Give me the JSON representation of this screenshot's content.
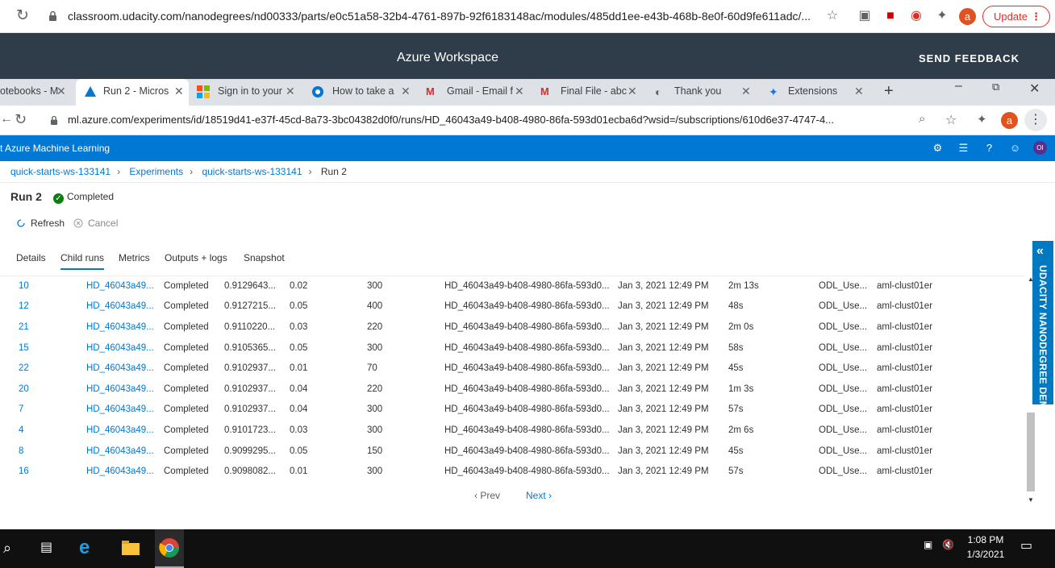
{
  "outer": {
    "url": "classroom.udacity.com/nanodegrees/nd00333/parts/e0c51a58-32b4-4761-897b-92f6183148ac/modules/485dd1ee-e43b-468b-8e0f-60d9fe611adc/...",
    "avatar": "a",
    "update": "Update"
  },
  "udacity": {
    "title": "Azure Workspace",
    "feedback": "SEND FEEDBACK"
  },
  "tabs": [
    {
      "label": "otebooks - M"
    },
    {
      "label": "Run 2 - Micros"
    },
    {
      "label": "Sign in to your"
    },
    {
      "label": "How to take a"
    },
    {
      "label": "Gmail - Email f"
    },
    {
      "label": "Final File - abc"
    },
    {
      "label": "Thank you"
    },
    {
      "label": "Extensions"
    }
  ],
  "inner": {
    "url": "ml.azure.com/experiments/id/18519d41-e37f-45cd-8a73-3bc04382d0f0/runs/HD_46043a49-b408-4980-86fa-593d01ecba6d?wsid=/subscriptions/610d6e37-4747-4...",
    "avatar": "a"
  },
  "aml": {
    "name": "t Azure Machine Learning",
    "user": "OI"
  },
  "breadcrumb": [
    "quick-starts-ws-133141",
    "Experiments",
    "quick-starts-ws-133141",
    "Run 2"
  ],
  "run": {
    "title": "Run 2",
    "status": "Completed"
  },
  "commands": {
    "refresh": "Refresh",
    "cancel": "Cancel"
  },
  "detail_tabs": [
    "Details",
    "Child runs",
    "Metrics",
    "Outputs + logs",
    "Snapshot"
  ],
  "rows": [
    {
      "num": "10",
      "id": "HD_46043a49...",
      "status": "Completed",
      "acc": "0.9129643...",
      "c": "0.02",
      "iter": "300",
      "parent": "HD_46043a49-b408-4980-86fa-593d0...",
      "date": "Jan 3, 2021 12:49 PM",
      "dur": "2m 13s",
      "user": "ODL_Use...",
      "target": "aml-clust01er"
    },
    {
      "num": "12",
      "id": "HD_46043a49...",
      "status": "Completed",
      "acc": "0.9127215...",
      "c": "0.05",
      "iter": "400",
      "parent": "HD_46043a49-b408-4980-86fa-593d0...",
      "date": "Jan 3, 2021 12:49 PM",
      "dur": "48s",
      "user": "ODL_Use...",
      "target": "aml-clust01er"
    },
    {
      "num": "21",
      "id": "HD_46043a49...",
      "status": "Completed",
      "acc": "0.9110220...",
      "c": "0.03",
      "iter": "220",
      "parent": "HD_46043a49-b408-4980-86fa-593d0...",
      "date": "Jan 3, 2021 12:49 PM",
      "dur": "2m 0s",
      "user": "ODL_Use...",
      "target": "aml-clust01er"
    },
    {
      "num": "15",
      "id": "HD_46043a49...",
      "status": "Completed",
      "acc": "0.9105365...",
      "c": "0.05",
      "iter": "300",
      "parent": "HD_46043a49-b408-4980-86fa-593d0...",
      "date": "Jan 3, 2021 12:49 PM",
      "dur": "58s",
      "user": "ODL_Use...",
      "target": "aml-clust01er"
    },
    {
      "num": "22",
      "id": "HD_46043a49...",
      "status": "Completed",
      "acc": "0.9102937...",
      "c": "0.01",
      "iter": "70",
      "parent": "HD_46043a49-b408-4980-86fa-593d0...",
      "date": "Jan 3, 2021 12:49 PM",
      "dur": "45s",
      "user": "ODL_Use...",
      "target": "aml-clust01er"
    },
    {
      "num": "20",
      "id": "HD_46043a49...",
      "status": "Completed",
      "acc": "0.9102937...",
      "c": "0.04",
      "iter": "220",
      "parent": "HD_46043a49-b408-4980-86fa-593d0...",
      "date": "Jan 3, 2021 12:49 PM",
      "dur": "1m 3s",
      "user": "ODL_Use...",
      "target": "aml-clust01er"
    },
    {
      "num": "7",
      "id": "HD_46043a49...",
      "status": "Completed",
      "acc": "0.9102937...",
      "c": "0.04",
      "iter": "300",
      "parent": "HD_46043a49-b408-4980-86fa-593d0...",
      "date": "Jan 3, 2021 12:49 PM",
      "dur": "57s",
      "user": "ODL_Use...",
      "target": "aml-clust01er"
    },
    {
      "num": "4",
      "id": "HD_46043a49...",
      "status": "Completed",
      "acc": "0.9101723...",
      "c": "0.03",
      "iter": "300",
      "parent": "HD_46043a49-b408-4980-86fa-593d0...",
      "date": "Jan 3, 2021 12:49 PM",
      "dur": "2m 6s",
      "user": "ODL_Use...",
      "target": "aml-clust01er"
    },
    {
      "num": "8",
      "id": "HD_46043a49...",
      "status": "Completed",
      "acc": "0.9099295...",
      "c": "0.05",
      "iter": "150",
      "parent": "HD_46043a49-b408-4980-86fa-593d0...",
      "date": "Jan 3, 2021 12:49 PM",
      "dur": "45s",
      "user": "ODL_Use...",
      "target": "aml-clust01er"
    },
    {
      "num": "16",
      "id": "HD_46043a49...",
      "status": "Completed",
      "acc": "0.9098082...",
      "c": "0.01",
      "iter": "300",
      "parent": "HD_46043a49-b408-4980-86fa-593d0...",
      "date": "Jan 3, 2021 12:49 PM",
      "dur": "57s",
      "user": "ODL_Use...",
      "target": "aml-clust01er"
    }
  ],
  "pager": {
    "prev": "Prev",
    "next": "Next"
  },
  "sidebar_label": "UDACITY NANODEGREE DEMO",
  "clock": {
    "time": "1:08 PM",
    "date": "1/3/2021"
  },
  "colors": {
    "azure_blue": "#0078d4",
    "udacity_dark": "#2e3d49",
    "taskbar": "#101010",
    "success": "#107c10"
  }
}
